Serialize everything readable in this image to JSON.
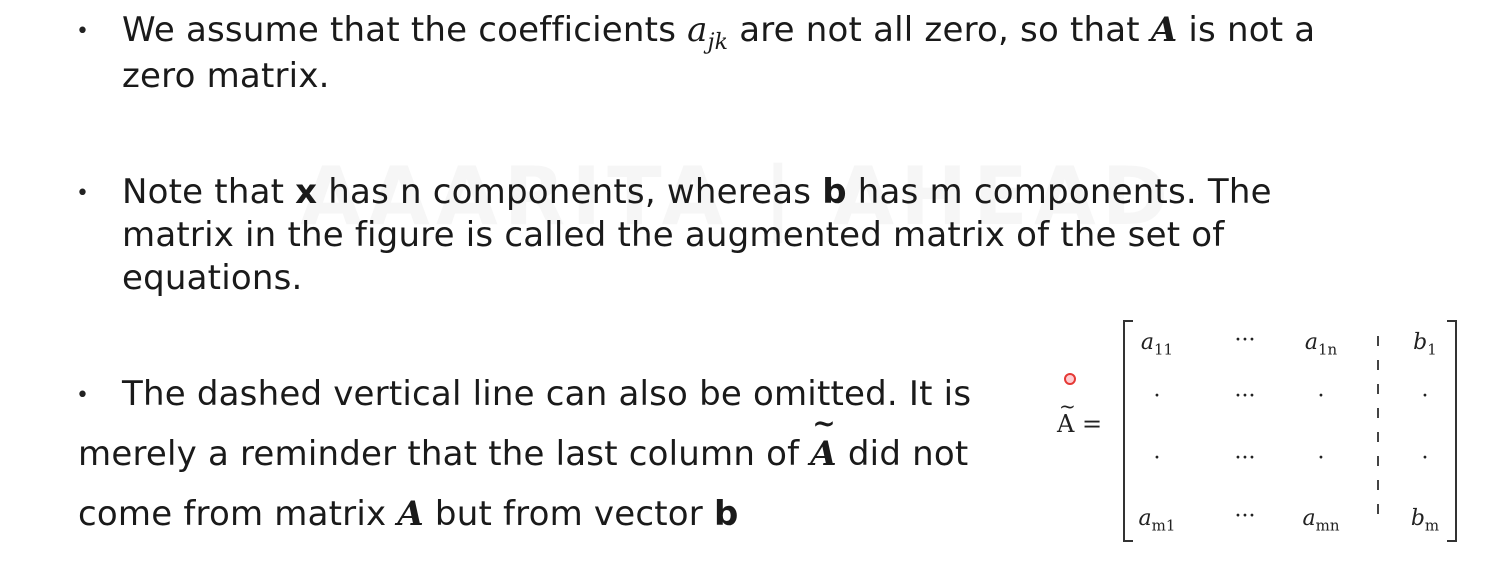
{
  "watermark": "AAARITA | AHEAD",
  "bullets": [
    {
      "part1": "We assume that the coefficients ",
      "var": "a",
      "sub": "jk",
      "part2": " are not all zero, so that ",
      "mat": "A",
      "part3": " is not a",
      "line2": "zero matrix."
    },
    {
      "part1": "Note that ",
      "x": "x",
      "part2": " has n components, whereas ",
      "b": "b",
      "part3": " has m components. The",
      "line2": "matrix in the figure is called the augmented matrix of the set of",
      "line3": "equations."
    },
    {
      "line1": "The dashed vertical line can also be omitted. It is",
      "line2a": "merely a reminder that the last column of ",
      "atilde": "A",
      "line2b": " did not",
      "line3a": "come from matrix ",
      "a": "A",
      "line3b": " but from vector ",
      "b": "b"
    }
  ],
  "bullet_glyph": "•",
  "tilde_glyph": "~",
  "matrix": {
    "label": "A",
    "equals": "=",
    "row1": {
      "c1": "a",
      "c1sub": "11",
      "dots": "···",
      "c2": "a",
      "c2sub": "1n",
      "b": "b",
      "bsub": "1"
    },
    "row2": {
      "c1": "·",
      "dots": "···",
      "c2": "·",
      "b": "·"
    },
    "row3": {
      "c1": "·",
      "dots": "···",
      "c2": "·",
      "b": "·"
    },
    "row4": {
      "c1": "a",
      "c1sub": "m1",
      "dots": "···",
      "c2": "a",
      "c2sub": "mn",
      "b": "b",
      "bsub": "m"
    }
  }
}
